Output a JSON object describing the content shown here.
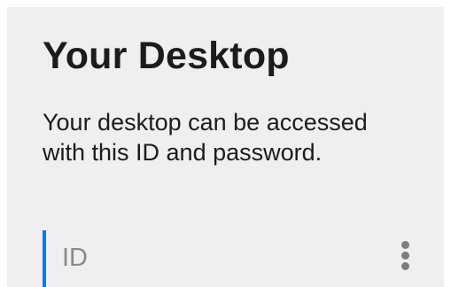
{
  "panel": {
    "title": "Your Desktop",
    "description": "Your desktop can be accessed with this ID and password."
  },
  "id_field": {
    "label": "ID",
    "menu_icon": "more-vertical-icon"
  },
  "colors": {
    "panel_background": "#efeff1",
    "focus_accent": "#1a73e8",
    "label_gray": "#8a8a8e"
  }
}
